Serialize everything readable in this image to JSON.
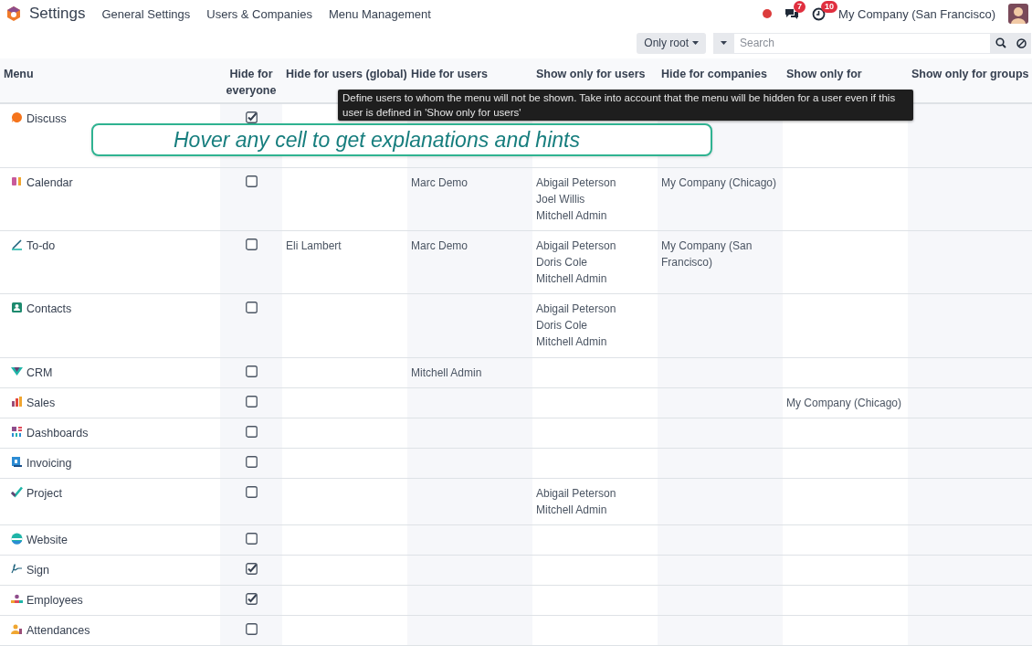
{
  "navbar": {
    "app_title": "Settings",
    "menu": [
      "General Settings",
      "Users & Companies",
      "Menu Management"
    ],
    "messages_badge": "7",
    "activities_badge": "10",
    "company": "My Company (San Francisco)"
  },
  "control_panel": {
    "filter_button": "Only root",
    "search": {
      "placeholder": "Search"
    }
  },
  "table": {
    "columns": [
      "Menu",
      "Hide for everyone",
      "Hide for users (global)",
      "Hide for users",
      "Show only for users",
      "Hide for companies",
      "Show only for",
      "Show only for groups"
    ],
    "rows": [
      {
        "name": "Discuss",
        "hide_for_everyone": true
      },
      {
        "name": "Calendar",
        "hide_for_everyone": false,
        "hide_users_personal": [
          "Marc Demo"
        ],
        "show_users": [
          "Abigail Peterson",
          "Joel Willis",
          "Mitchell Admin"
        ],
        "hide_companies": [
          "My Company (Chicago)"
        ]
      },
      {
        "name": "To-do",
        "hide_for_everyone": false,
        "hide_users_global": [
          "Eli Lambert"
        ],
        "hide_users_personal": [
          "Marc Demo"
        ],
        "show_users": [
          "Abigail Peterson",
          "Doris Cole",
          "Mitchell Admin"
        ],
        "hide_companies": [
          "My Company (San Francisco)"
        ]
      },
      {
        "name": "Contacts",
        "hide_for_everyone": false,
        "show_users": [
          "Abigail Peterson",
          "Doris Cole",
          "Mitchell Admin"
        ]
      },
      {
        "name": "CRM",
        "hide_for_everyone": false,
        "hide_users_personal": [
          "Mitchell Admin"
        ]
      },
      {
        "name": "Sales",
        "hide_for_everyone": false,
        "show_companies": [
          "My Company (Chicago)"
        ]
      },
      {
        "name": "Dashboards",
        "hide_for_everyone": false
      },
      {
        "name": "Invoicing",
        "hide_for_everyone": false
      },
      {
        "name": "Project",
        "hide_for_everyone": false,
        "show_users": [
          "Abigail Peterson",
          "Mitchell Admin"
        ]
      },
      {
        "name": "Website",
        "hide_for_everyone": false
      },
      {
        "name": "Sign",
        "hide_for_everyone": true
      },
      {
        "name": "Employees",
        "hide_for_everyone": true
      },
      {
        "name": "Attendances",
        "hide_for_everyone": false
      }
    ]
  },
  "tooltip": "Define users to whom the menu will not be shown. Take into account that the menu will be hidden for a user even if this user is defined in 'Show only for users'",
  "callout": "Hover any cell to get explanations and hints"
}
